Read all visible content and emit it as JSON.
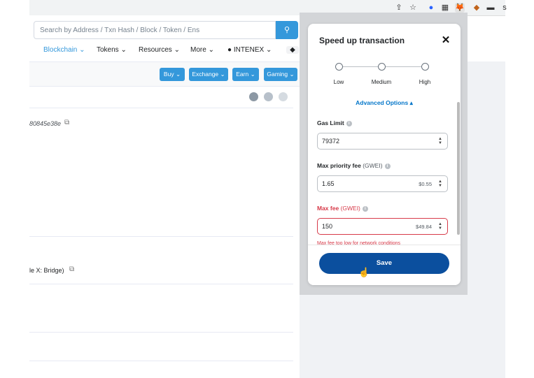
{
  "toolbar": {
    "extensions": [
      {
        "name": "share-icon",
        "glyph": "⇪"
      },
      {
        "name": "star-icon",
        "glyph": "☆"
      },
      {
        "name": "extension-blue-icon",
        "glyph": "●"
      },
      {
        "name": "extension-qr-icon",
        "glyph": "▦"
      },
      {
        "name": "metamask-fox-icon",
        "glyph": "🦊"
      },
      {
        "name": "extension-badge-icon",
        "glyph": "◆"
      },
      {
        "name": "extension-dark-icon",
        "glyph": "▬"
      },
      {
        "name": "extension-s-icon",
        "glyph": "s"
      }
    ]
  },
  "explorer": {
    "search_placeholder": "Search by Address / Txn Hash / Block / Token / Ens",
    "nav": [
      "Blockchain",
      "Tokens",
      "Resources",
      "More",
      "INTENEX"
    ],
    "pills": [
      "Buy",
      "Exchange",
      "Earn",
      "Gaming"
    ],
    "hash_fragment": "80845e38e",
    "bridge_fragment": "le X: Bridge)"
  },
  "modal": {
    "title": "Speed up transaction",
    "speed_options": [
      "Low",
      "Medium",
      "High"
    ],
    "advanced_label": "Advanced Options",
    "gas_limit_label": "Gas Limit",
    "gas_limit_value": "79372",
    "priority_fee_label": "Max priority fee",
    "priority_fee_unit": "(GWEI)",
    "priority_fee_value": "1.65",
    "priority_fee_fiat": "$0.55",
    "max_fee_label": "Max fee",
    "max_fee_unit": "(GWEI)",
    "max_fee_value": "150",
    "max_fee_fiat": "$49.84",
    "error": "Max fee too low for network conditions",
    "save_label": "Save"
  },
  "colors": {
    "accent": "#3498db",
    "save": "#0b4f9e",
    "link": "#0376c9",
    "error": "#d73a49"
  }
}
